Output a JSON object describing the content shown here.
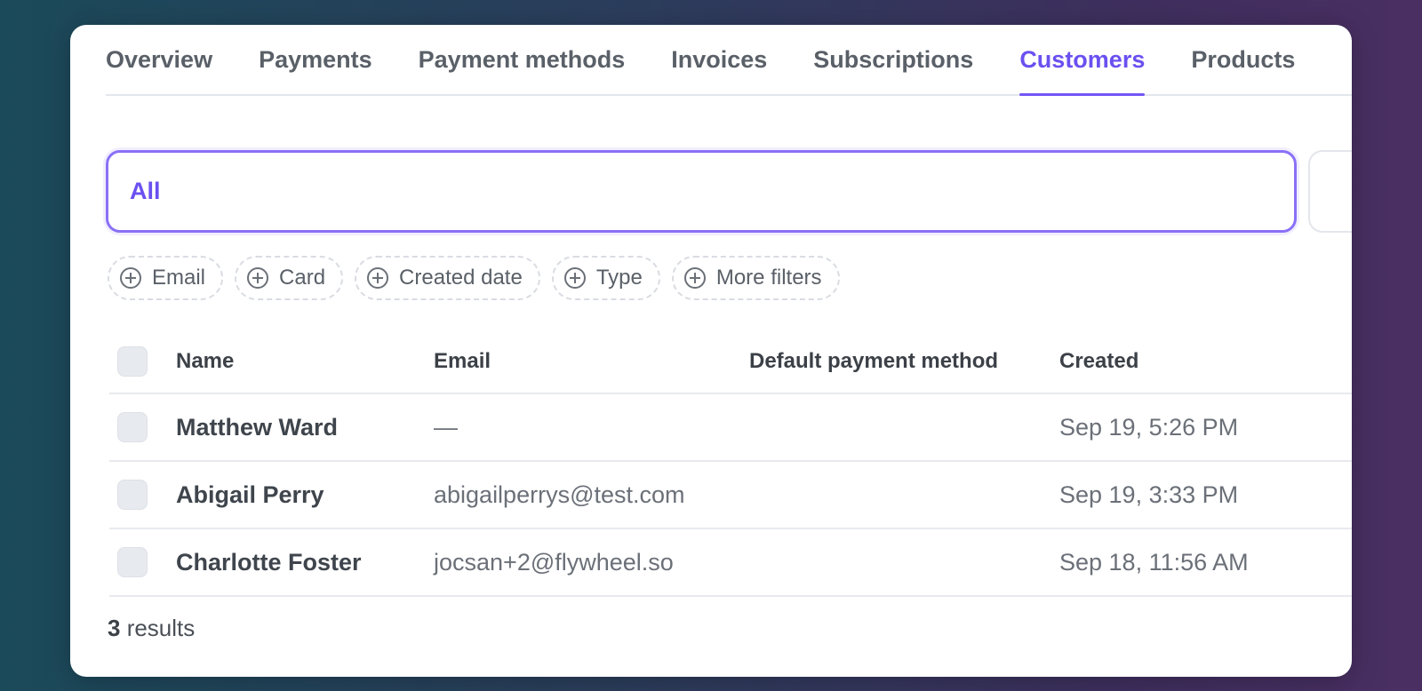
{
  "tabs": [
    {
      "label": "Overview",
      "active": false
    },
    {
      "label": "Payments",
      "active": false
    },
    {
      "label": "Payment methods",
      "active": false
    },
    {
      "label": "Invoices",
      "active": false
    },
    {
      "label": "Subscriptions",
      "active": false
    },
    {
      "label": "Customers",
      "active": true
    },
    {
      "label": "Products",
      "active": false
    }
  ],
  "search": {
    "value": "All"
  },
  "filters": [
    {
      "label": "Email",
      "icon": "plus-circle-icon"
    },
    {
      "label": "Card",
      "icon": "plus-circle-icon"
    },
    {
      "label": "Created date",
      "icon": "plus-circle-icon"
    },
    {
      "label": "Type",
      "icon": "plus-circle-icon"
    },
    {
      "label": "More filters",
      "icon": "plus-circle-icon"
    }
  ],
  "table": {
    "columns": {
      "name": "Name",
      "email": "Email",
      "payment_method": "Default payment method",
      "created": "Created"
    },
    "rows": [
      {
        "name": "Matthew Ward",
        "email": "—",
        "payment_method": "",
        "created": "Sep 19, 5:26 PM"
      },
      {
        "name": "Abigail Perry",
        "email": "abigailperrys@test.com",
        "payment_method": "",
        "created": "Sep 19, 3:33 PM"
      },
      {
        "name": "Charlotte Foster",
        "email": "jocsan+2@flywheel.so",
        "payment_method": "",
        "created": "Sep 18, 11:56 AM"
      }
    ]
  },
  "footer": {
    "count": "3",
    "label": " results"
  },
  "colors": {
    "accent": "#6b50f0",
    "border": "#e3e6eb"
  }
}
